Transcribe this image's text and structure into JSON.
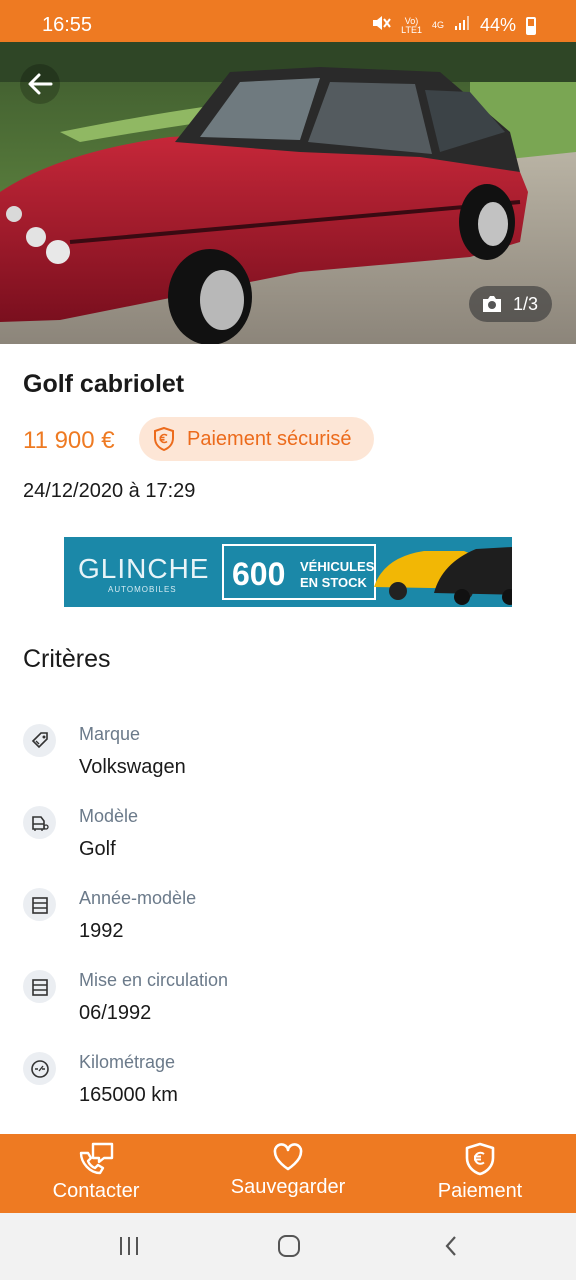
{
  "status_bar": {
    "time": "16:55",
    "network_top": "Vo)",
    "network_bottom": "LTE1",
    "data_type": "4G",
    "battery": "44%"
  },
  "gallery": {
    "counter": "1/3"
  },
  "listing": {
    "title": "Golf cabriolet",
    "price": "11 900 €",
    "secure_payment_label": "Paiement sécurisé",
    "date": "24/12/2020 à 17:29"
  },
  "ad": {
    "brand": "GLINCHE",
    "brand_sub": "AUTOMOBILES",
    "count": "600",
    "line1": "VÉHICULES",
    "line2": "EN STOCK"
  },
  "criteria": {
    "section_title": "Critères",
    "items": [
      {
        "label": "Marque",
        "value": "Volkswagen",
        "icon": "tag-icon"
      },
      {
        "label": "Modèle",
        "value": "Golf",
        "icon": "car-model-icon"
      },
      {
        "label": "Année-modèle",
        "value": "1992",
        "icon": "calendar-icon"
      },
      {
        "label": "Mise en circulation",
        "value": "06/1992",
        "icon": "calendar-icon"
      },
      {
        "label": "Kilométrage",
        "value": "165000 km",
        "icon": "speedometer-icon"
      }
    ]
  },
  "actions": [
    {
      "label": "Contacter",
      "icon": "contact-icon"
    },
    {
      "label": "Sauvegarder",
      "icon": "heart-icon"
    },
    {
      "label": "Paiement",
      "icon": "euro-shield-icon"
    }
  ],
  "colors": {
    "accent": "#ee7a22",
    "pill_bg": "#fde6d6",
    "label_gray": "#6b7a8a"
  }
}
